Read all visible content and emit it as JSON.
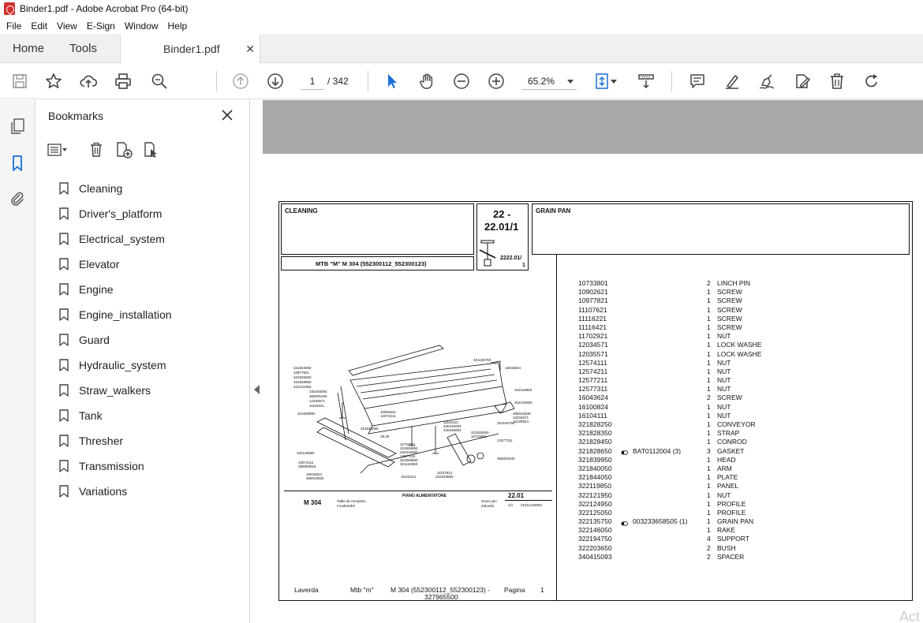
{
  "window": {
    "title": "Binder1.pdf - Adobe Acrobat Pro (64-bit)"
  },
  "menu": [
    "File",
    "Edit",
    "View",
    "E-Sign",
    "Window",
    "Help"
  ],
  "tabs": {
    "home": "Home",
    "tools": "Tools",
    "document": "Binder1.pdf"
  },
  "toolbar": {
    "page_current": "1",
    "page_total": "/  342",
    "zoom": "65.2%"
  },
  "bookmarks": {
    "title": "Bookmarks",
    "items": [
      "Cleaning",
      "Driver's_platform",
      "Electrical_system",
      "Elevator",
      "Engine",
      "Engine_installation",
      "Guard",
      "Hydraulic_system",
      "Straw_walkers",
      "Tank",
      "Thresher",
      "Transmission",
      "Variations"
    ]
  },
  "sheet": {
    "group_left": "CLEANING",
    "group_number": "22 -",
    "group_number2": "22.01/1",
    "group_right": "GRAIN PAN",
    "model_label": "MTB \"M\" M 304 (552300112_552300123)",
    "sub_ref": "2222.01/",
    "sub_ref2": "1",
    "drawing_model": "M 304",
    "drawing_title": "PIANO ALIMENTATORE",
    "drawing_number": "22.01",
    "drawing_caption_left": "Table de reception",
    "drawing_caption_left2": "Foodertafel",
    "drawing_caption_right": "Grain pan",
    "drawing_caption_right2": "Zuluvda",
    "drawing_page": "1/1",
    "drawing_code": "22311134902"
  },
  "parts": [
    {
      "code": "10733801",
      "ref": "",
      "qty": "2",
      "desc": "LINCH PIN"
    },
    {
      "code": "10902621",
      "ref": "",
      "qty": "1",
      "desc": "SCREW"
    },
    {
      "code": "10977821",
      "ref": "",
      "qty": "1",
      "desc": "SCREW"
    },
    {
      "code": "11107621",
      "ref": "",
      "qty": "1",
      "desc": "SCREW"
    },
    {
      "code": "11116221",
      "ref": "",
      "qty": "1",
      "desc": "SCREW"
    },
    {
      "code": "11116421",
      "ref": "",
      "qty": "1",
      "desc": "SCREW"
    },
    {
      "code": "11702921",
      "ref": "",
      "qty": "1",
      "desc": "NUT"
    },
    {
      "code": "12034571",
      "ref": "",
      "qty": "1",
      "desc": "LOCK WASHE"
    },
    {
      "code": "12035571",
      "ref": "",
      "qty": "1",
      "desc": "LOCK WASHE"
    },
    {
      "code": "12574111",
      "ref": "",
      "qty": "1",
      "desc": "NUT"
    },
    {
      "code": "12574211",
      "ref": "",
      "qty": "1",
      "desc": "NUT"
    },
    {
      "code": "12577211",
      "ref": "",
      "qty": "1",
      "desc": "NUT"
    },
    {
      "code": "12577311",
      "ref": "",
      "qty": "1",
      "desc": "NUT"
    },
    {
      "code": "16043624",
      "ref": "",
      "qty": "2",
      "desc": "SCREW"
    },
    {
      "code": "16100824",
      "ref": "",
      "qty": "1",
      "desc": "NUT"
    },
    {
      "code": "16104111",
      "ref": "",
      "qty": "1",
      "desc": "NUT"
    },
    {
      "code": "321828250",
      "ref": "",
      "qty": "1",
      "desc": "CONVEYOR"
    },
    {
      "code": "321828350",
      "ref": "",
      "qty": "1",
      "desc": "STRAP"
    },
    {
      "code": "321828450",
      "ref": "",
      "qty": "1",
      "desc": "CONROD"
    },
    {
      "code": "321828650",
      "ref": "BAT0112004  (3)",
      "qty": "3",
      "desc": "GASKET"
    },
    {
      "code": "321839950",
      "ref": "",
      "qty": "1",
      "desc": "HEAD"
    },
    {
      "code": "321840050",
      "ref": "",
      "qty": "1",
      "desc": "ARM"
    },
    {
      "code": "321844050",
      "ref": "",
      "qty": "1",
      "desc": "PLATE"
    },
    {
      "code": "322119850",
      "ref": "",
      "qty": "1",
      "desc": "PANEL"
    },
    {
      "code": "322121950",
      "ref": "",
      "qty": "1",
      "desc": "NUT"
    },
    {
      "code": "322124950",
      "ref": "",
      "qty": "1",
      "desc": "PROFILE"
    },
    {
      "code": "322125050",
      "ref": "",
      "qty": "1",
      "desc": "PROFILE"
    },
    {
      "code": "322135750",
      "ref": "003233658505  (1)",
      "qty": "1",
      "desc": "GRAIN PAN"
    },
    {
      "code": "322146050",
      "ref": "",
      "qty": "1",
      "desc": "RAKE"
    },
    {
      "code": "322194750",
      "ref": "",
      "qty": "4",
      "desc": "SUPPORT"
    },
    {
      "code": "322203650",
      "ref": "",
      "qty": "2",
      "desc": "BUSH"
    },
    {
      "code": "340415093",
      "ref": "",
      "qty": "2",
      "desc": "SPACER"
    }
  ],
  "footer": {
    "brand": "Laverda",
    "series": "Mtb \"m\"",
    "model": "M 304 (552300112_552300123)  -",
    "model2": "327965500",
    "page_label": "Pagina",
    "page_num": "1"
  },
  "watermark": "Act"
}
